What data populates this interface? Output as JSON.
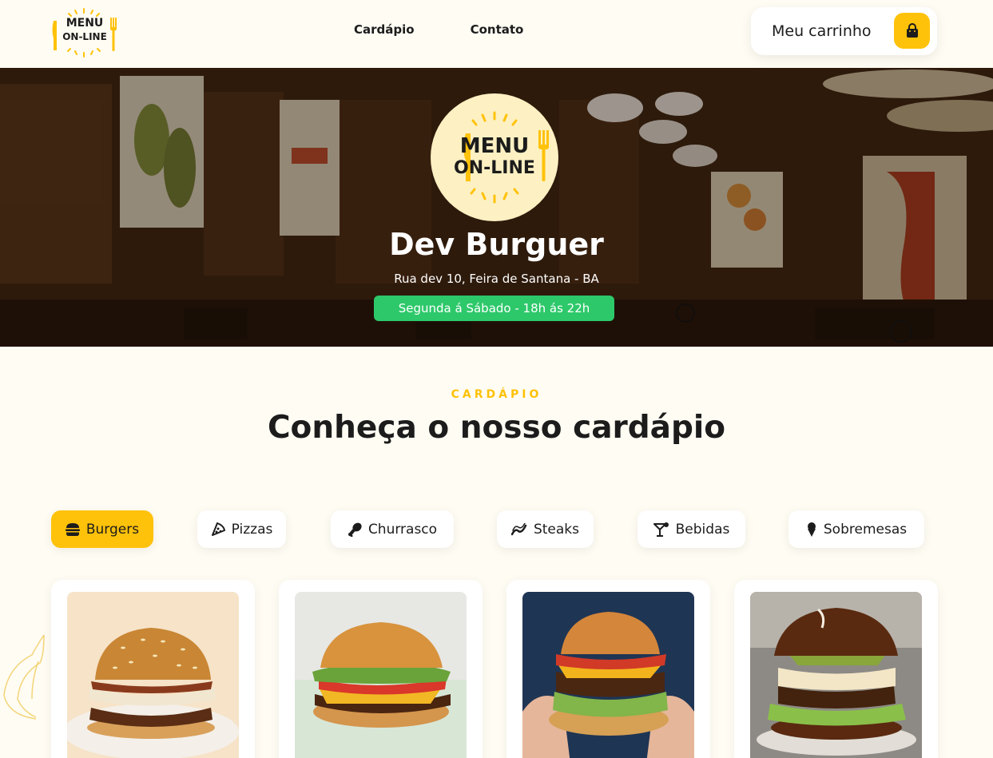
{
  "header": {
    "logo_line1": "MENU",
    "logo_line2": "ON-LINE",
    "nav": [
      {
        "label": "Cardápio"
      },
      {
        "label": "Contato"
      }
    ],
    "cart_label": "Meu carrinho",
    "cart_icon": "shopping-bag-icon"
  },
  "banner": {
    "logo_line1": "MENU",
    "logo_line2": "ON-LINE",
    "store_name": "Dev Burguer",
    "address": "Rua dev 10, Feira de Santana - BA",
    "hours": "Segunda á Sábado - 18h ás 22h"
  },
  "menu": {
    "subtitle": "CARDÁPIO",
    "title": "Conheça o nosso cardápio",
    "categories": [
      {
        "label": "Burgers",
        "icon": "burger-icon",
        "active": true
      },
      {
        "label": "Pizzas",
        "icon": "pizza-icon",
        "active": false
      },
      {
        "label": "Churrasco",
        "icon": "drumstick-icon",
        "active": false
      },
      {
        "label": "Steaks",
        "icon": "bacon-icon",
        "active": false
      },
      {
        "label": "Bebidas",
        "icon": "cocktail-icon",
        "active": false
      },
      {
        "label": "Sobremesas",
        "icon": "ice-cream-icon",
        "active": false
      }
    ]
  },
  "colors": {
    "accent": "#ffc20a",
    "success": "#2dc86a",
    "background": "#fffcf3"
  }
}
